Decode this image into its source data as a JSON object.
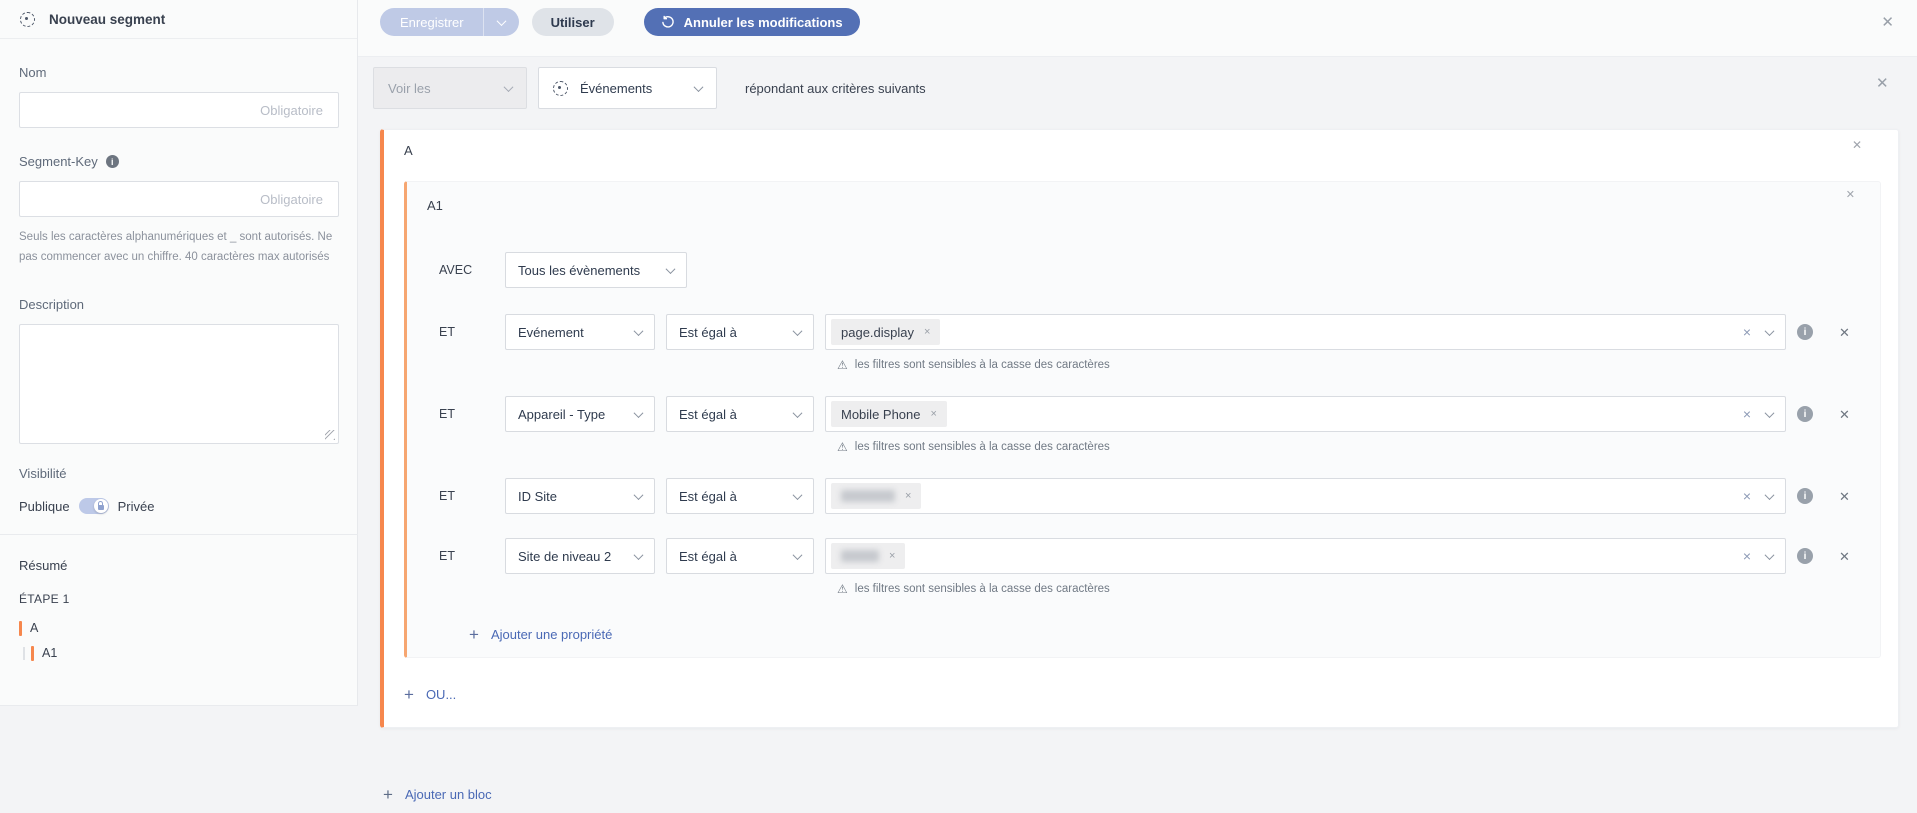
{
  "sidebar": {
    "title": "Nouveau segment",
    "nom": {
      "label": "Nom",
      "placeholder": "Obligatoire"
    },
    "segment_key": {
      "label": "Segment-Key",
      "placeholder": "Obligatoire",
      "help": "Seuls les caractères alphanumériques et _ sont autorisés. Ne pas commencer avec un chiffre. 40 caractères max autorisés"
    },
    "description": {
      "label": "Description"
    },
    "visibility": {
      "label": "Visibilité",
      "public": "Publique",
      "private": "Privée",
      "state": "Privée"
    },
    "summary": {
      "title": "Résumé",
      "step": "ÉTAPE 1",
      "items": [
        {
          "label": "A",
          "depth": 0
        },
        {
          "label": "A1",
          "depth": 1
        }
      ]
    }
  },
  "toolbar": {
    "save": "Enregistrer",
    "use": "Utiliser",
    "undo": "Annuler les modifications"
  },
  "scope": {
    "view": "Voir les",
    "entity": "Événements",
    "suffix": "répondant aux critères suivants"
  },
  "segment": {
    "block": {
      "label": "A",
      "sub_block": {
        "label": "A1",
        "scope_row": {
          "label": "AVEC",
          "value": "Tous les évènements"
        },
        "rows": [
          {
            "connector": "ET",
            "property": "Evénement",
            "operator": "Est égal à",
            "tags": [
              {
                "label": "page.display"
              }
            ],
            "warning": true
          },
          {
            "connector": "ET",
            "property": "Appareil - Type",
            "operator": "Est égal à",
            "tags": [
              {
                "label": "Mobile Phone"
              }
            ],
            "warning": true
          },
          {
            "connector": "ET",
            "property": "ID Site",
            "operator": "Est égal à",
            "tags": [
              {
                "redacted": true,
                "width": 54
              }
            ],
            "warning": false
          },
          {
            "connector": "ET",
            "property": "Site de niveau 2",
            "operator": "Est égal à",
            "tags": [
              {
                "redacted": true,
                "width": 38
              }
            ],
            "warning": true
          }
        ],
        "add_property": "Ajouter une propriété"
      },
      "add_or": "OU..."
    },
    "add_block": "Ajouter un bloc"
  },
  "warning_text": "les filtres sont sensibles à la casse des caractères",
  "icons": {
    "close": "✕",
    "clear": "×",
    "tag_remove": "×",
    "warning": "⚠",
    "info": "i",
    "plus": "+"
  },
  "colors": {
    "accent_orange": "#f6874d",
    "accent_orange_light": "#f6a671",
    "primary_blue": "#5370b5",
    "disabled_blue": "#bfcae6",
    "link_blue": "#4a69b5"
  }
}
